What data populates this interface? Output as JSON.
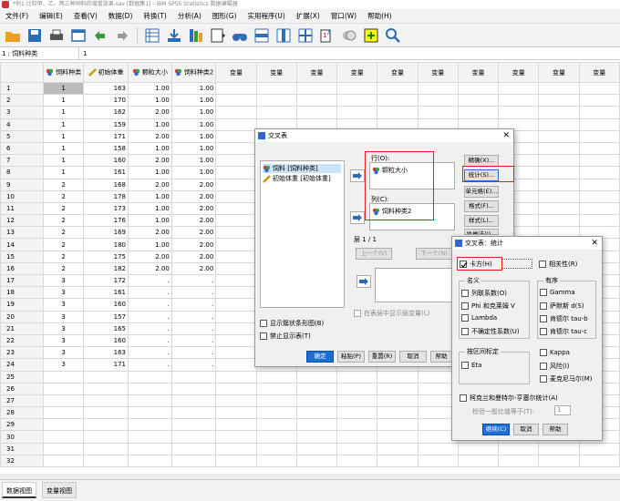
{
  "window": {
    "title": "*例1 比较甲、乙、两三种饲料的增重效果.sav [数据集1] - IBM SPSS Statistics 数据编辑器"
  },
  "menu": [
    "文件(F)",
    "编辑(E)",
    "查看(V)",
    "数据(D)",
    "转换(T)",
    "分析(A)",
    "图形(G)",
    "实用程序(U)",
    "扩展(X)",
    "窗口(W)",
    "帮助(H)"
  ],
  "cellbar": {
    "ref": "1 : 饲料种类",
    "value": "1"
  },
  "grid": {
    "headers": [
      "饲料种类",
      "初始体重",
      "颗粒大小",
      "饲料种类2",
      "变量",
      "变量",
      "变量",
      "变量",
      "变量",
      "变量",
      "变量",
      "变量",
      "变量",
      "变量"
    ],
    "rows": [
      [
        "1",
        "1",
        "163",
        "1.00",
        "1.00"
      ],
      [
        "2",
        "1",
        "170",
        "1.00",
        "1.00"
      ],
      [
        "3",
        "1",
        "162",
        "2.00",
        "1.00"
      ],
      [
        "4",
        "1",
        "159",
        "1.00",
        "1.00"
      ],
      [
        "5",
        "1",
        "171",
        "2.00",
        "1.00"
      ],
      [
        "6",
        "1",
        "158",
        "1.00",
        "1.00"
      ],
      [
        "7",
        "1",
        "160",
        "2.00",
        "1.00"
      ],
      [
        "8",
        "1",
        "161",
        "1.00",
        "1.00"
      ],
      [
        "9",
        "2",
        "168",
        "2.00",
        "2.00"
      ],
      [
        "10",
        "2",
        "178",
        "1.00",
        "2.00"
      ],
      [
        "11",
        "2",
        "173",
        "1.00",
        "2.00"
      ],
      [
        "12",
        "2",
        "176",
        "1.00",
        "2.00"
      ],
      [
        "13",
        "2",
        "169",
        "2.00",
        "2.00"
      ],
      [
        "14",
        "2",
        "180",
        "1.00",
        "2.00"
      ],
      [
        "15",
        "2",
        "175",
        "2.00",
        "2.00"
      ],
      [
        "16",
        "2",
        "182",
        "2.00",
        "2.00"
      ],
      [
        "17",
        "3",
        "172",
        ".",
        "."
      ],
      [
        "18",
        "3",
        "161",
        ".",
        "."
      ],
      [
        "19",
        "3",
        "160",
        ".",
        "."
      ],
      [
        "20",
        "3",
        "157",
        ".",
        "."
      ],
      [
        "21",
        "3",
        "165",
        ".",
        "."
      ],
      [
        "22",
        "3",
        "160",
        ".",
        "."
      ],
      [
        "23",
        "3",
        "163",
        ".",
        "."
      ],
      [
        "24",
        "3",
        "171",
        ".",
        "."
      ],
      [
        "25",
        "",
        "",
        "",
        ""
      ],
      [
        "26",
        "",
        "",
        "",
        ""
      ],
      [
        "27",
        "",
        "",
        "",
        ""
      ],
      [
        "28",
        "",
        "",
        "",
        ""
      ],
      [
        "29",
        "",
        "",
        "",
        ""
      ],
      [
        "30",
        "",
        "",
        "",
        ""
      ],
      [
        "31",
        "",
        "",
        "",
        ""
      ],
      [
        "32",
        "",
        "",
        "",
        ""
      ]
    ]
  },
  "tabs": {
    "data_view": "数据视图",
    "variable_view": "变量视图"
  },
  "crosstabs": {
    "title": "交叉表",
    "source_vars": [
      "饲料 [饲料种类]",
      "初始体重 [初始体重]"
    ],
    "row_label": "行(O):",
    "row_var": "颗粒大小",
    "col_label": "列(C):",
    "col_var": "饲料种类2",
    "layer_label": "层 1 / 1",
    "prev_btn": "上一个(V)",
    "next_btn": "下一个(N)",
    "layer_check": "在表层中显示层变量(L)",
    "clustered_bar": "显示簇状条形图(B)",
    "suppress_tables": "禁止显示表(T)",
    "side_buttons": [
      "精确(X)...",
      "统计(S)...",
      "单元格(E)...",
      "格式(F)...",
      "样式(L)...",
      "执举法(I)..."
    ],
    "ok": "确定",
    "paste": "粘贴(P)",
    "reset": "重置(R)",
    "cancel": "取消",
    "help": "帮助"
  },
  "statistics": {
    "title": "交叉表：统计",
    "chisq": "卡方(H)",
    "correlations": "相关性(R)",
    "nominal_title": "名义",
    "nominal": [
      "列联系数(O)",
      "Phi 和克莱姆 V",
      "Lambda",
      "不确定性系数(U)"
    ],
    "ordinal_title": "有序",
    "ordinal": [
      "Gamma",
      "萨默斯 d(S)",
      "肯德尔 tau-b",
      "肯德尔 tau-c"
    ],
    "interval_title": "按区间标定",
    "eta": "Eta",
    "kappa": "Kappa",
    "risk": "风险(I)",
    "mcnemar": "麦克尼马尔(M)",
    "cmh": "柯克兰和曼特尔-亨塞尔统计(A)",
    "common_odds": "检验一般比值等于(T):",
    "common_odds_val": "1",
    "continue": "继续(C)",
    "cancel": "取消",
    "help": "帮助"
  }
}
